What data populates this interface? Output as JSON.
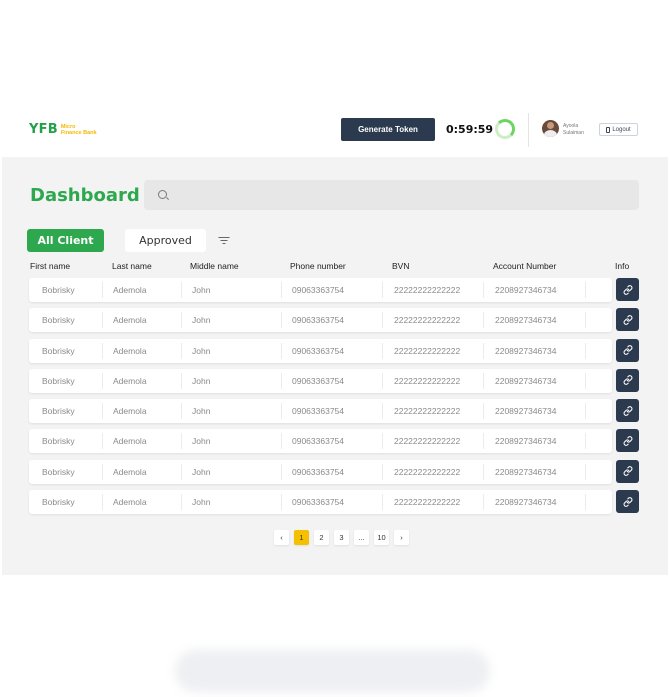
{
  "header": {
    "logo_mark": "YFB",
    "logo_line1": "Micro",
    "logo_line2": "Finance Bank",
    "generate_label": "Generate Token",
    "timer": "0:59:59",
    "user_first": "Ayoola",
    "user_last": "Sulaiman",
    "logout_label": "Logout"
  },
  "main": {
    "title": "Dashboard",
    "search_placeholder": "",
    "tabs": [
      {
        "label": "All Client",
        "active": true
      },
      {
        "label": "Approved",
        "active": false
      }
    ]
  },
  "table": {
    "columns": [
      "First name",
      "Last name",
      "Middle name",
      "Phone number",
      "BVN",
      "Account Number",
      "Info"
    ],
    "rows": [
      {
        "first": "Bobrisky",
        "last": "Ademola",
        "middle": "John",
        "phone": "09063363754",
        "bvn": "22222222222222",
        "account": "2208927346734"
      },
      {
        "first": "Bobrisky",
        "last": "Ademola",
        "middle": "John",
        "phone": "09063363754",
        "bvn": "22222222222222",
        "account": "2208927346734"
      },
      {
        "first": "Bobrisky",
        "last": "Ademola",
        "middle": "John",
        "phone": "09063363754",
        "bvn": "22222222222222",
        "account": "2208927346734"
      },
      {
        "first": "Bobrisky",
        "last": "Ademola",
        "middle": "John",
        "phone": "09063363754",
        "bvn": "22222222222222",
        "account": "2208927346734"
      },
      {
        "first": "Bobrisky",
        "last": "Ademola",
        "middle": "John",
        "phone": "09063363754",
        "bvn": "22222222222222",
        "account": "2208927346734"
      },
      {
        "first": "Bobrisky",
        "last": "Ademola",
        "middle": "John",
        "phone": "09063363754",
        "bvn": "22222222222222",
        "account": "2208927346734"
      },
      {
        "first": "Bobrisky",
        "last": "Ademola",
        "middle": "John",
        "phone": "09063363754",
        "bvn": "22222222222222",
        "account": "2208927346734"
      },
      {
        "first": "Bobrisky",
        "last": "Ademola",
        "middle": "John",
        "phone": "09063363754",
        "bvn": "22222222222222",
        "account": "2208927346734"
      }
    ],
    "info_icon": "link-icon"
  },
  "pagination": {
    "prev": "‹",
    "pages": [
      "1",
      "2",
      "3",
      "...",
      "10"
    ],
    "current": "1",
    "next": "›"
  },
  "colors": {
    "brand_green": "#2ea84f",
    "brand_yellow": "#f5b800",
    "navy": "#2b3a4f",
    "background": "#f3f3f3"
  }
}
